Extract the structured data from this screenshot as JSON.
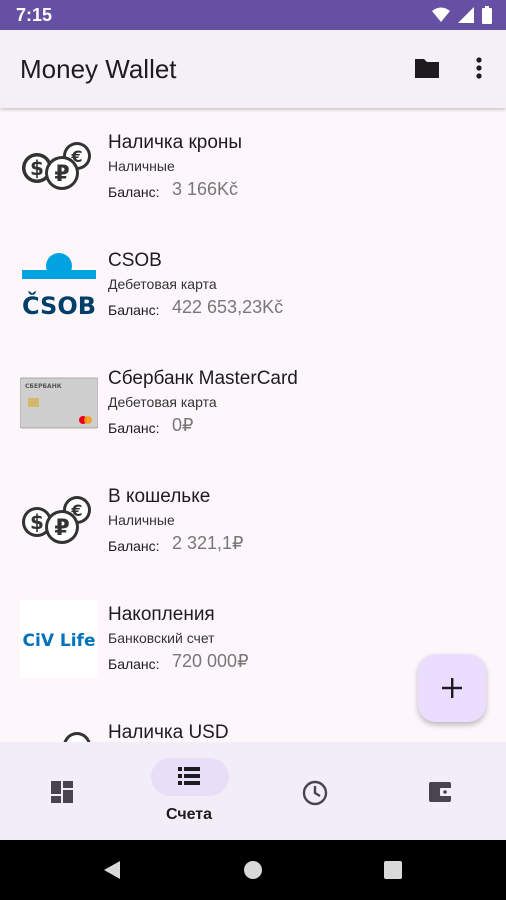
{
  "status_bar": {
    "time": "7:15"
  },
  "app_bar": {
    "title": "Money Wallet",
    "folder_icon": "folder-icon",
    "more_icon": "more-vert-icon"
  },
  "accounts": [
    {
      "name": "Наличка кроны",
      "type": "Наличные",
      "balance_label": "Баланс:",
      "balance": "3 166Kč",
      "logo": "coins-logo"
    },
    {
      "name": "CSOB",
      "type": "Дебетовая карта",
      "balance_label": "Баланс:",
      "balance": "422 653,23Kč",
      "logo": "csob-logo",
      "logo_text": "ČSOB"
    },
    {
      "name": "Сбербанк MasterCard",
      "type": "Дебетовая карта",
      "balance_label": "Баланс:",
      "balance": "0₽",
      "logo": "sberbank-card-logo",
      "logo_text": "СБЕРБАНК"
    },
    {
      "name": "В кошельке",
      "type": "Наличные",
      "balance_label": "Баланс:",
      "balance": "2 321,1₽",
      "logo": "coins-logo"
    },
    {
      "name": "Накопления",
      "type": "Банковский счет",
      "balance_label": "Баланс:",
      "balance": "720 000₽",
      "logo": "civ-life-logo",
      "logo_text": "CiV Life"
    },
    {
      "name": "Наличка USD",
      "type": "",
      "balance_label": "",
      "balance": "",
      "logo": "coins-logo"
    }
  ],
  "fab": {
    "icon": "add-icon"
  },
  "bottom_nav": [
    {
      "label": "",
      "icon": "dashboard-icon",
      "active": false
    },
    {
      "label": "Счета",
      "icon": "list-icon",
      "active": true
    },
    {
      "label": "",
      "icon": "clock-icon",
      "active": false
    },
    {
      "label": "",
      "icon": "wallet-icon",
      "active": false
    }
  ],
  "colors": {
    "status_bar": "#6650a4",
    "app_bar": "#f5f0f7",
    "fab": "#eaddff",
    "nav_pill": "#e8def8",
    "background": "#fdf7fc"
  }
}
